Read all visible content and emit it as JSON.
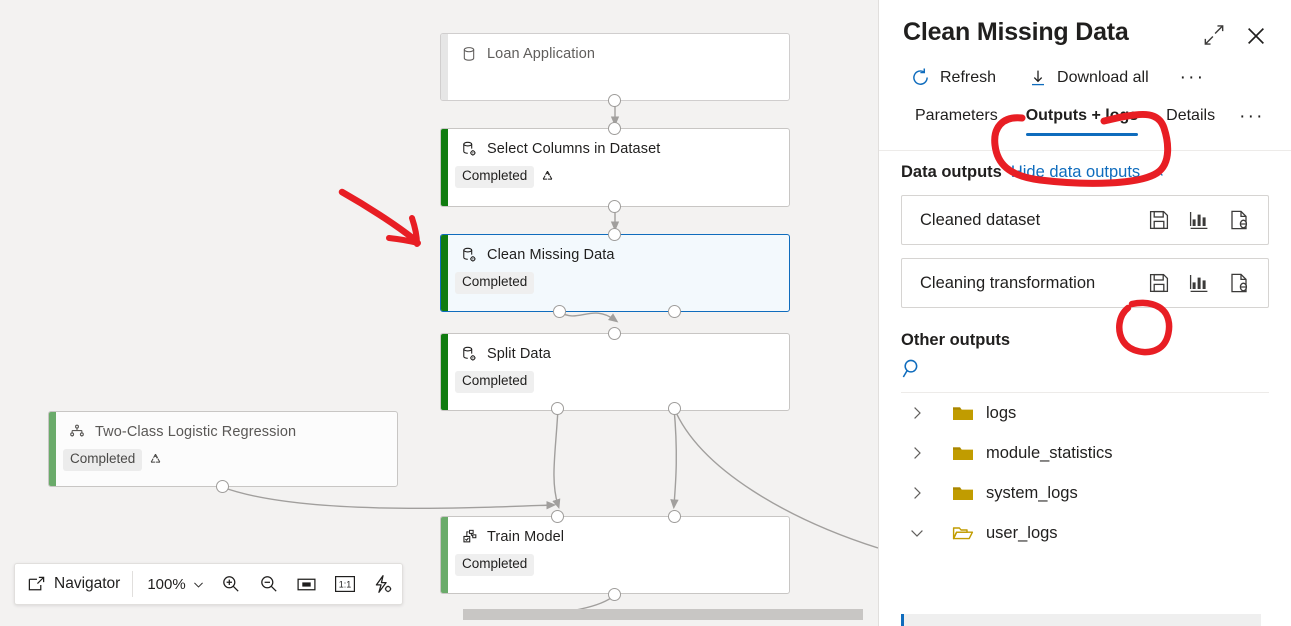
{
  "canvas": {
    "nodes": [
      {
        "name": "Loan Application",
        "status": null,
        "reuse": false,
        "icon": "dataset-icon",
        "state": "dataset"
      },
      {
        "name": "Select Columns in Dataset",
        "status": "Completed",
        "reuse": true,
        "icon": "module-icon",
        "state": "normal"
      },
      {
        "name": "Clean Missing Data",
        "status": "Completed",
        "reuse": false,
        "icon": "module-icon",
        "state": "selected"
      },
      {
        "name": "Split Data",
        "status": "Completed",
        "reuse": false,
        "icon": "module-icon",
        "state": "normal"
      },
      {
        "name": "Two-Class Logistic Regression",
        "status": "Completed",
        "reuse": true,
        "icon": "algorithm-icon",
        "state": "faded"
      },
      {
        "name": "Train Model",
        "status": "Completed",
        "reuse": false,
        "icon": "train-model-icon",
        "state": "normal"
      }
    ],
    "navigator": {
      "label": "Navigator",
      "icon": "navigator-icon",
      "zoom": "100%",
      "chevron": "chevron-down-icon",
      "buttons": [
        {
          "icon": "zoom-in-icon"
        },
        {
          "icon": "zoom-out-icon"
        },
        {
          "icon": "fit-to-screen-icon"
        },
        {
          "icon": "actual-size-icon",
          "label": "1:1"
        },
        {
          "icon": "auto-layout-icon"
        }
      ]
    }
  },
  "panel": {
    "title": "Clean Missing Data",
    "header_icons": [
      {
        "name": "expand-icon"
      },
      {
        "name": "close-icon"
      }
    ],
    "commands": [
      {
        "label": "Refresh",
        "icon": "refresh-icon"
      },
      {
        "label": "Download all",
        "icon": "download-icon"
      }
    ],
    "overflow": "···",
    "tabs": [
      {
        "label": "Parameters",
        "active": false
      },
      {
        "label": "Outputs + logs",
        "active": true
      },
      {
        "label": "Details",
        "active": false
      }
    ],
    "data_outputs": {
      "heading": "Data outputs",
      "toggle_link": "Hide data outputs",
      "toggle_icon": "chevron-up-icon",
      "rows": [
        {
          "label": "Cleaned dataset",
          "icons": [
            "save-icon",
            "visualize-icon",
            "register-dataset-icon"
          ]
        },
        {
          "label": "Cleaning transformation",
          "icons": [
            "save-icon",
            "visualize-icon",
            "register-dataset-icon"
          ]
        }
      ]
    },
    "other_outputs": {
      "heading": "Other outputs",
      "search_icon": "search-icon",
      "tree": [
        {
          "label": "logs",
          "expanded": false,
          "chevron": "chevron-right-icon",
          "folder": "folder-closed-icon"
        },
        {
          "label": "module_statistics",
          "expanded": false,
          "chevron": "chevron-right-icon",
          "folder": "folder-closed-icon"
        },
        {
          "label": "system_logs",
          "expanded": false,
          "chevron": "chevron-right-icon",
          "folder": "folder-closed-icon"
        },
        {
          "label": "user_logs",
          "expanded": true,
          "chevron": "chevron-down-icon",
          "folder": "folder-open-icon"
        }
      ]
    }
  },
  "annotations": {
    "color": "#e81e24",
    "items": [
      {
        "name": "arrow-to-clean-missing-data",
        "type": "arrow"
      },
      {
        "name": "circle-outputs-logs-tab",
        "type": "circle"
      },
      {
        "name": "circle-save-cleaning-transformation",
        "type": "circle"
      }
    ]
  },
  "colors": {
    "accent": "#0f6cbd",
    "node_success": "#107c10",
    "canvas_bg": "#f3f2f1",
    "panel_bg": "#ffffff",
    "folder": "#c19c00",
    "annotation_red": "#e81e24"
  }
}
